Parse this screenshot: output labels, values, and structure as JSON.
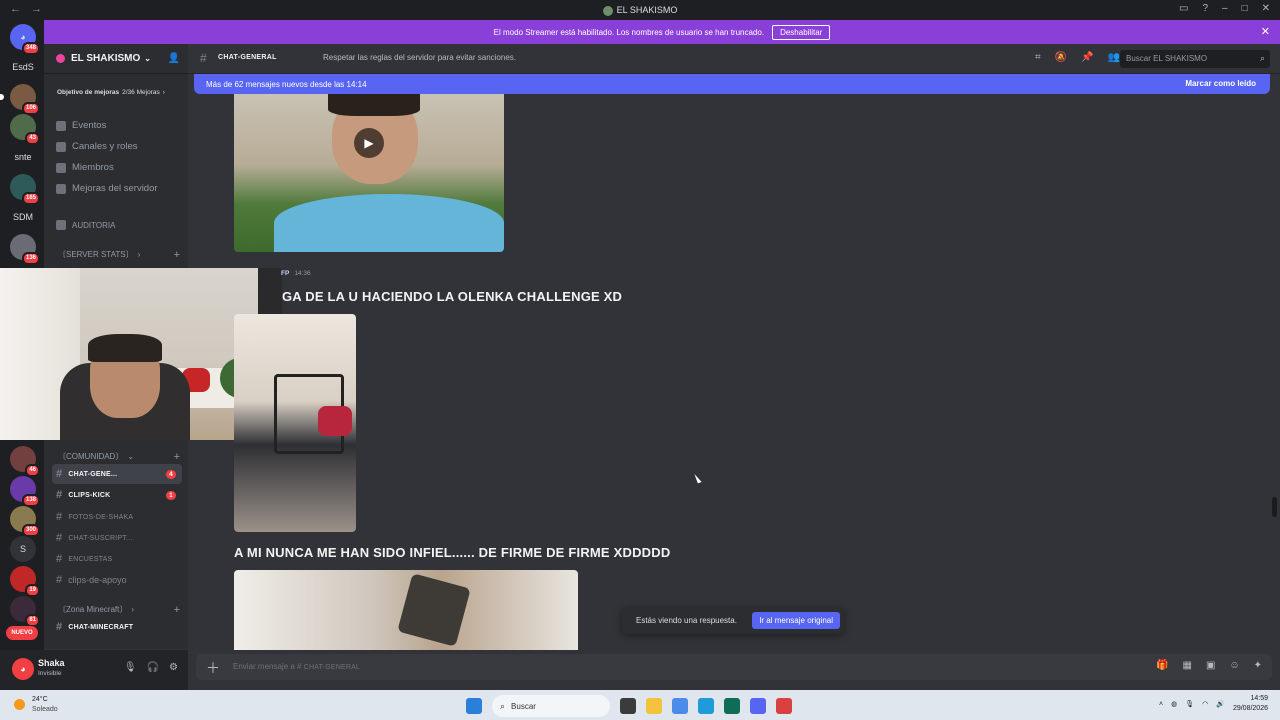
{
  "window": {
    "title": "EL SHAKISMO"
  },
  "streamer_banner": {
    "text": "El modo Streamer está habilitado. Los nombres de usuario se han truncado.",
    "button": "Deshabilitar"
  },
  "server_rail": {
    "items": [
      {
        "label": "",
        "badge": "348",
        "icon": "discord-home-icon"
      },
      {
        "label": "EsdS",
        "badge": ""
      },
      {
        "label": "",
        "badge": "106"
      },
      {
        "label": "",
        "badge": "43"
      },
      {
        "label": "snte",
        "badge": ""
      },
      {
        "label": "",
        "badge": "165"
      },
      {
        "label": "SDM",
        "badge": ""
      },
      {
        "label": "",
        "badge": "136"
      },
      {
        "label": "",
        "badge": "46"
      },
      {
        "label": "",
        "badge": "138"
      },
      {
        "label": "",
        "badge": "300"
      },
      {
        "label": "S",
        "badge": ""
      },
      {
        "label": "",
        "badge": "19"
      },
      {
        "label": "",
        "badge": "81"
      },
      {
        "label": "NUEVO",
        "badge": ""
      }
    ]
  },
  "guild": {
    "name": "EL SHAKISMO",
    "boost_goal": "Objetivo de mejoras",
    "boost_count": "2/36 Mejoras",
    "menu": [
      "Eventos",
      "Canales y roles",
      "Miembros",
      "Mejoras del servidor"
    ],
    "audit": "AUDITORIA",
    "categories": {
      "server_stats": "〔SERVER STATS〕",
      "comunidad": "〔COMUNIDAD〕",
      "minecraft": "〔Zona Minecraft〕"
    },
    "channels": [
      {
        "name": "CHAT-GENE...",
        "count": "4",
        "state": "active"
      },
      {
        "name": "CLIPS-KICK",
        "count": "1",
        "state": "unread"
      },
      {
        "name": "FOTOS-DE-SHAKA",
        "count": "",
        "state": "read"
      },
      {
        "name": "CHAT-SUSCRIPT...",
        "count": "",
        "state": "read"
      },
      {
        "name": "ENCUESTAS",
        "count": "",
        "state": "read"
      },
      {
        "name": "clips-de-apoyo",
        "count": "",
        "state": "read"
      }
    ],
    "minecraft_channel": "CHAT-MINECRAFT"
  },
  "user_panel": {
    "name": "Shaka",
    "status": "Invisible"
  },
  "header": {
    "channel": "CHAT-GENERAL",
    "topic": "Respetar las reglas del servidor para evitar sanciones.",
    "search_placeholder": "Buscar EL SHAKISMO"
  },
  "new_messages": {
    "text": "Más de 62 mensajes nuevos desde las 14:14",
    "mark_read": "Marcar como leído"
  },
  "messages": [
    {
      "tag": "FP",
      "time": "14:36",
      "text": "GA DE LA U HACIENDO LA OLENKA CHALLENGE XD"
    },
    {
      "text": "A MI NUNCA ME HAN SIDO INFIEL...... DE FIRME DE FIRME XDDDDD"
    }
  ],
  "reply_toast": {
    "text": "Estás viendo una respuesta.",
    "button": "Ir al mensaje original"
  },
  "composer": {
    "placeholder": "Enviar mensaje a #",
    "channel": "CHAT-GENERAL"
  },
  "taskbar": {
    "weather_temp": "24°C",
    "weather_cond": "Soleado",
    "search": "Buscar",
    "time": "14:59",
    "date": "29/08/2026"
  }
}
